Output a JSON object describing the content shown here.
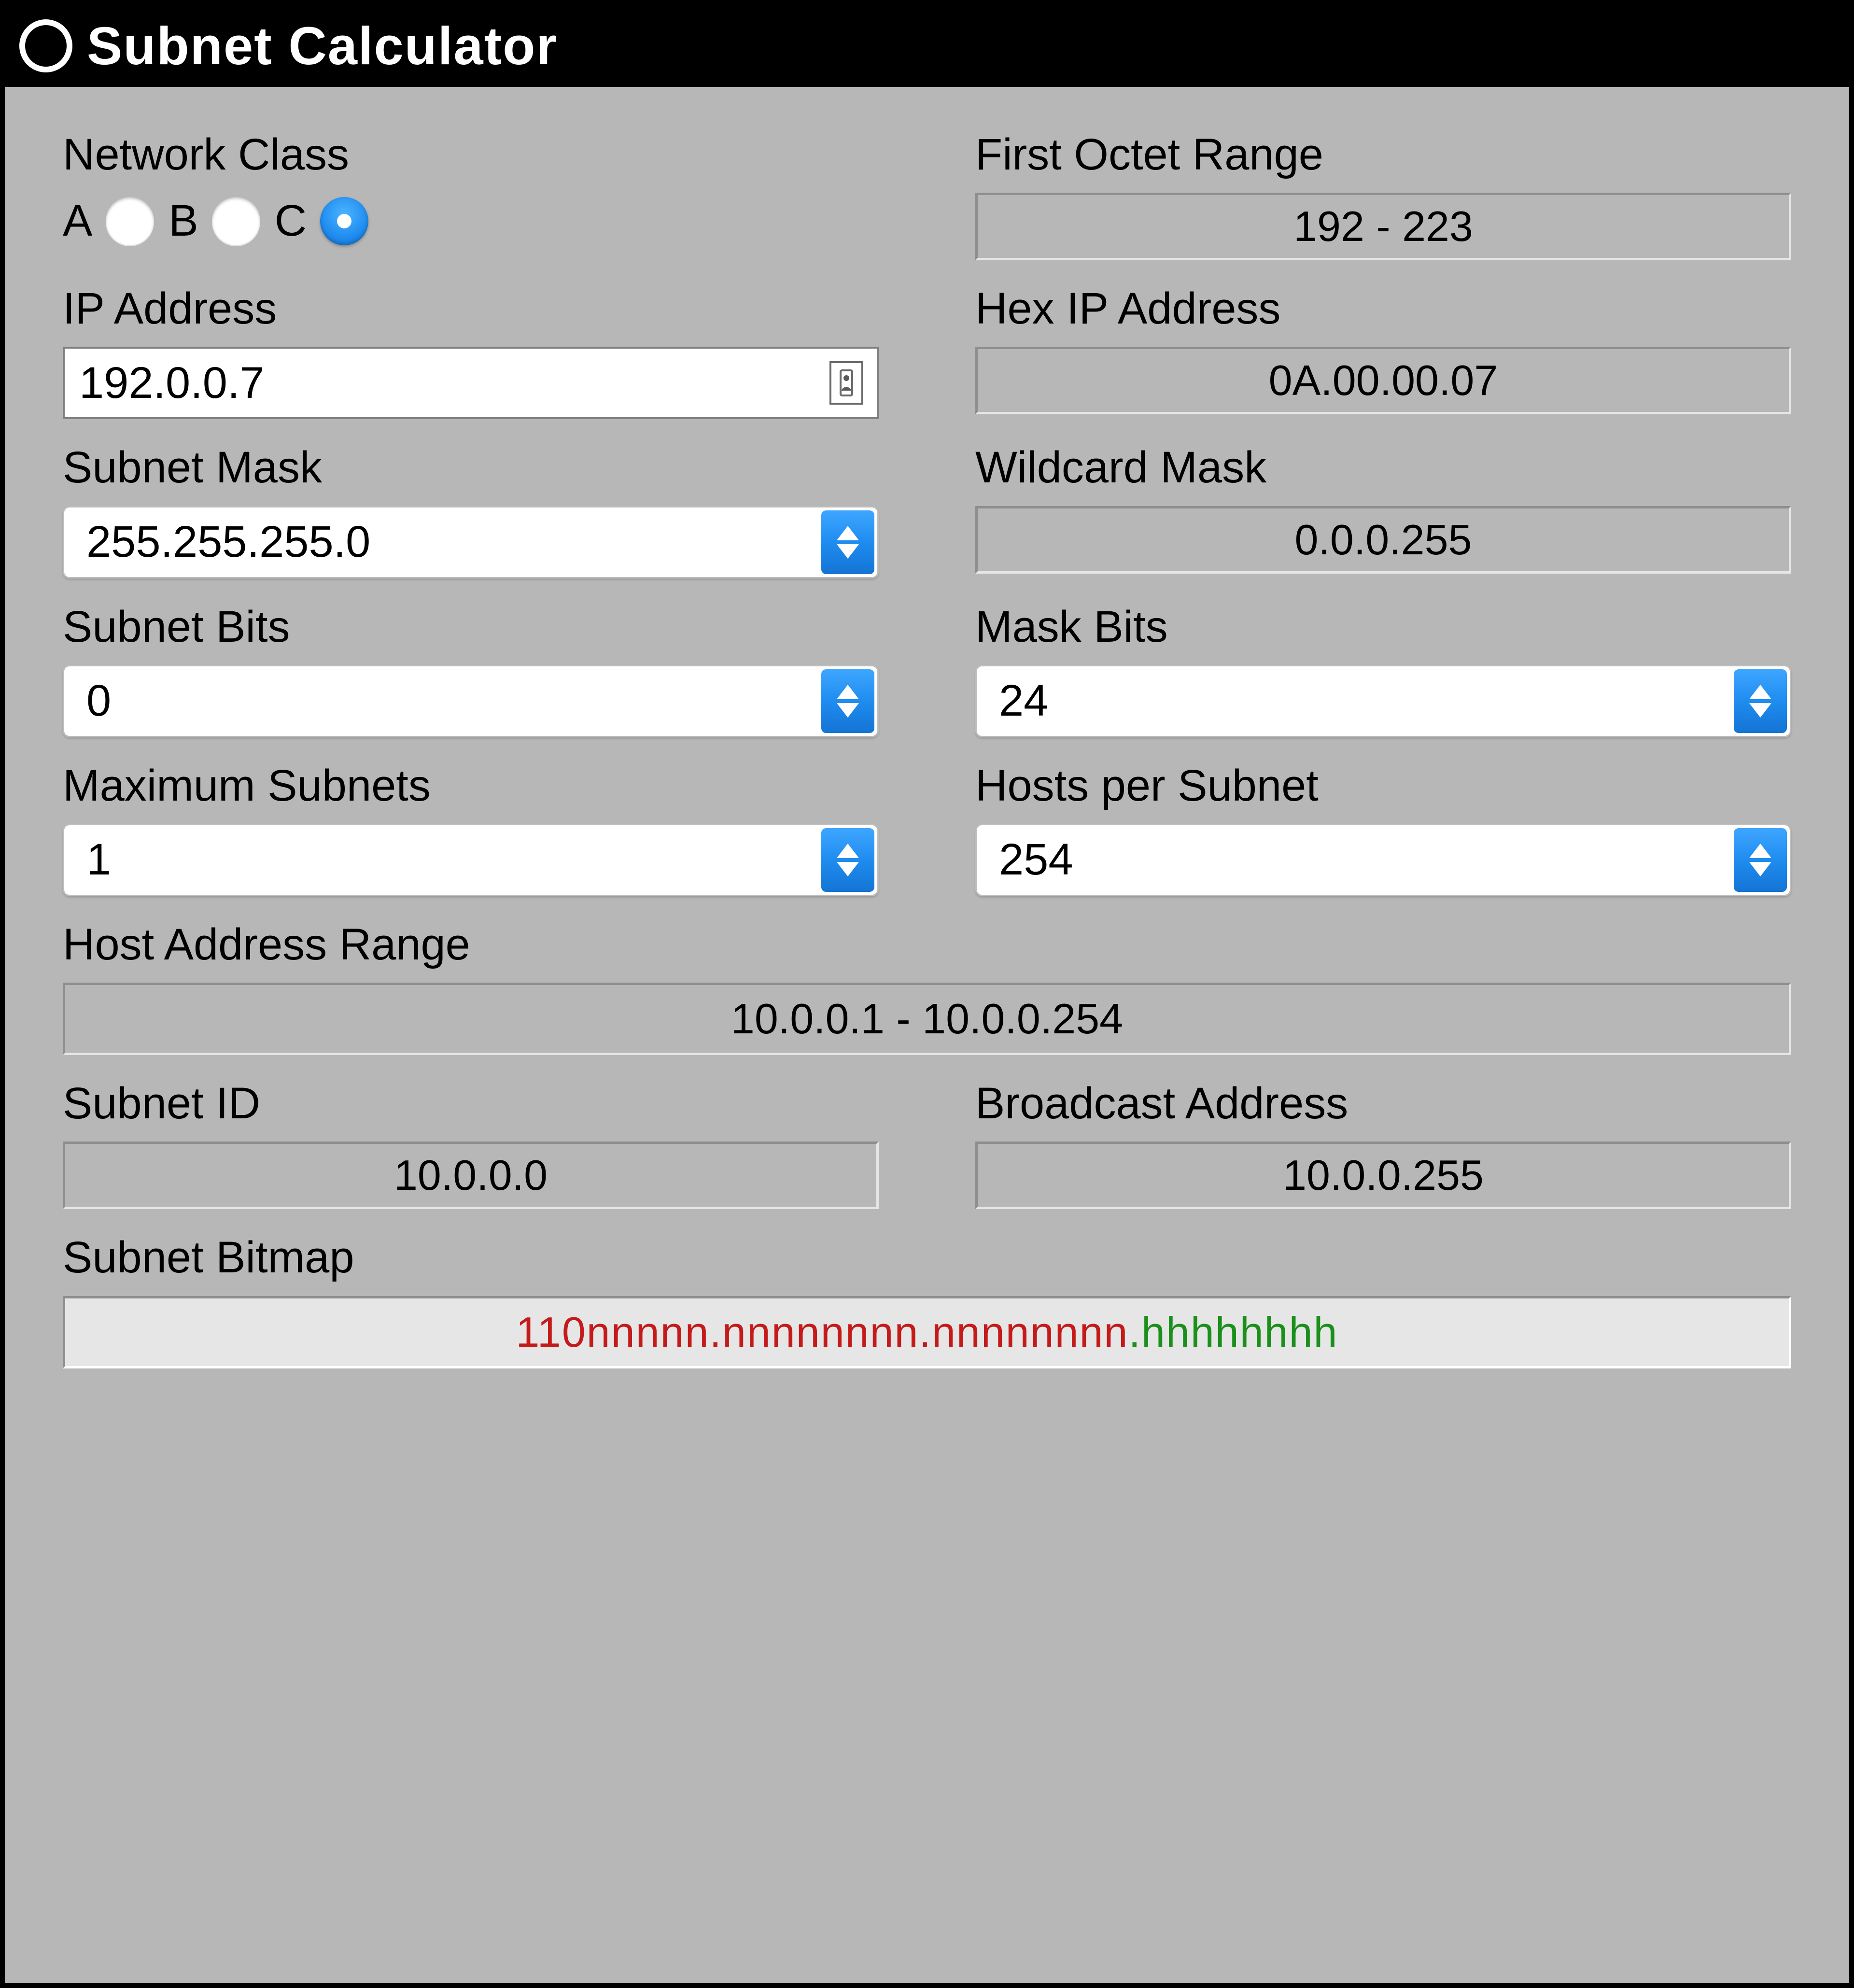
{
  "window": {
    "title": "Subnet Calculator"
  },
  "labels": {
    "network_class": "Network Class",
    "first_octet_range": "First Octet Range",
    "ip_address": "IP Address",
    "hex_ip_address": "Hex IP Address",
    "subnet_mask": "Subnet Mask",
    "wildcard_mask": "Wildcard Mask",
    "subnet_bits": "Subnet Bits",
    "mask_bits": "Mask Bits",
    "maximum_subnets": "Maximum Subnets",
    "hosts_per_subnet": "Hosts per Subnet",
    "host_address_range": "Host Address Range",
    "subnet_id": "Subnet ID",
    "broadcast_address": "Broadcast Address",
    "subnet_bitmap": "Subnet Bitmap"
  },
  "network_class": {
    "options": {
      "a": "A",
      "b": "B",
      "c": "C"
    },
    "selected": "c"
  },
  "values": {
    "first_octet_range": "192 - 223",
    "ip_address": "192.0.0.7",
    "hex_ip_address": "0A.00.00.07",
    "subnet_mask": "255.255.255.0",
    "wildcard_mask": "0.0.0.255",
    "subnet_bits": "0",
    "mask_bits": "24",
    "maximum_subnets": "1",
    "hosts_per_subnet": "254",
    "host_address_range": "10.0.0.1 - 10.0.0.254",
    "subnet_id": "10.0.0.0",
    "broadcast_address": "10.0.0.255"
  },
  "bitmap": {
    "seg1": "110nnnnn",
    "seg2": "nnnnnnnn",
    "seg3": "nnnnnnnn",
    "seg4": "hhhhhhhh"
  }
}
